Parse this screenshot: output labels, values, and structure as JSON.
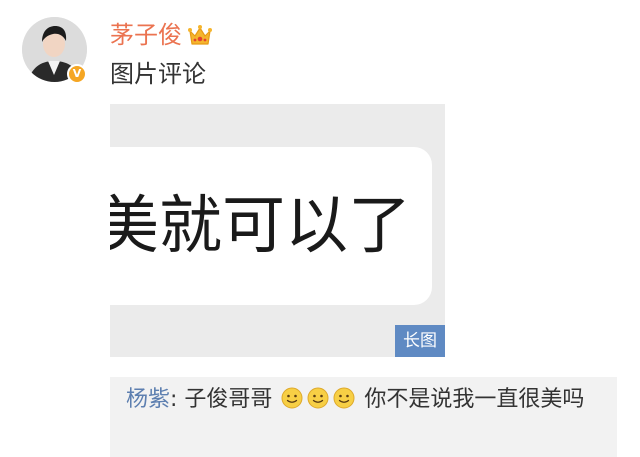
{
  "post": {
    "username": "茅子俊",
    "text": "图片评论",
    "verified_badge": "V",
    "crown_icon": "crown-icon",
    "image": {
      "visible_text": "美就可以了",
      "long_image_label": "长图"
    }
  },
  "comment": {
    "author": "杨紫",
    "separator": ": ",
    "text_before": "子俊哥哥 ",
    "emojis": [
      "smile-emoji",
      "smile-emoji",
      "smile-emoji"
    ],
    "text_after": " 你不是说我一直很美吗"
  },
  "colors": {
    "username": "#eb7350",
    "commenter": "#5d7fb0",
    "long_image_tag": "#5f8ac3",
    "comment_bg": "#f2f2f2"
  }
}
